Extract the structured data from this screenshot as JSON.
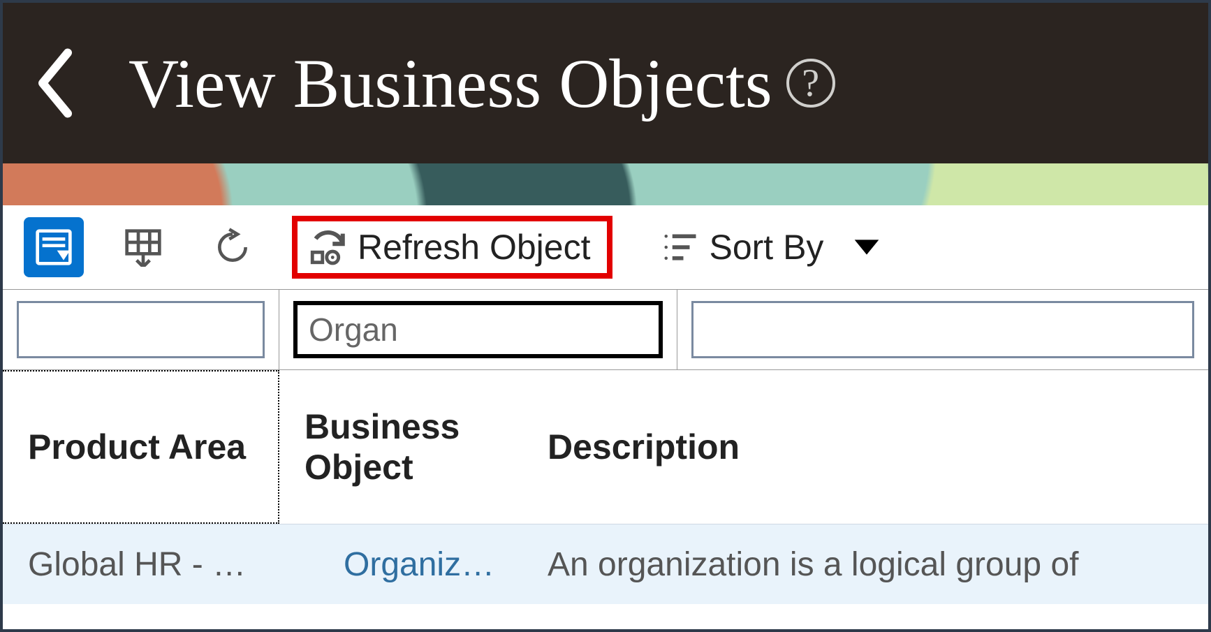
{
  "header": {
    "title": "View Business Objects",
    "help_glyph": "?"
  },
  "toolbar": {
    "refresh_label": "Refresh Object",
    "sort_label": "Sort By"
  },
  "filters": {
    "product_area": "",
    "business_object": "Organ",
    "description": ""
  },
  "columns": {
    "product_area": "Product Area",
    "business_object": "Business Object",
    "description": "Description"
  },
  "rows": [
    {
      "product_area": "Global HR - …",
      "business_object": "Organization",
      "description": "An organization is a logical group of"
    }
  ]
}
